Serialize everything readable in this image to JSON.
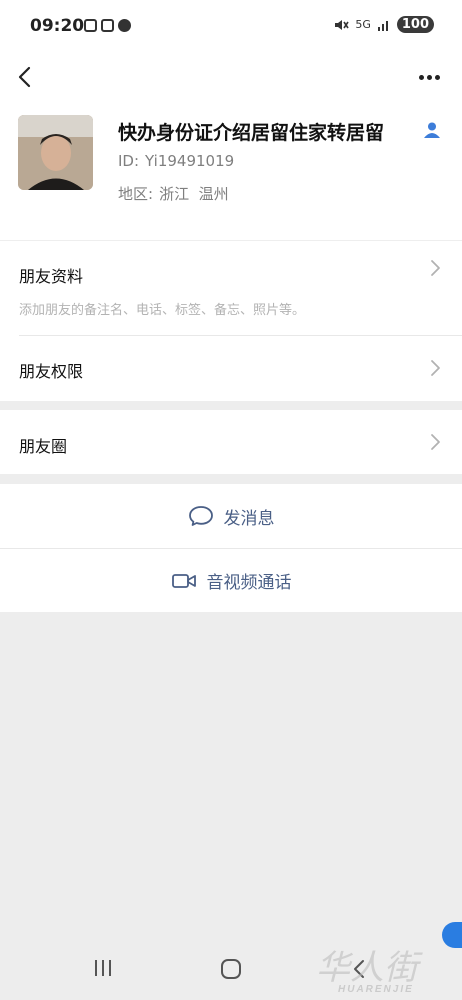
{
  "status_bar": {
    "time": "09:20",
    "network": "5G",
    "battery": "100"
  },
  "nav": {
    "back_icon": "chevron-left-icon",
    "more_icon": "more-horizontal-icon"
  },
  "profile": {
    "name": "快办身份证介绍居留住家转居留",
    "id_label": "ID:",
    "id_value": "Yi19491019",
    "region_label": "地区:",
    "region_value": "浙江  温州"
  },
  "rows": {
    "friend_info": {
      "title": "朋友资料",
      "subtitle": "添加朋友的备注名、电话、标签、备忘、照片等。"
    },
    "friend_permissions": {
      "title": "朋友权限"
    },
    "moments": {
      "title": "朋友圈"
    }
  },
  "actions": {
    "send_message": "发消息",
    "video_call": "音视频通话"
  },
  "watermark": {
    "text": "华人街",
    "subtext": "HUARENJIE"
  },
  "colors": {
    "action_text": "#4a5f86",
    "background": "#ededed",
    "verified_blue": "#3d7dd9"
  }
}
